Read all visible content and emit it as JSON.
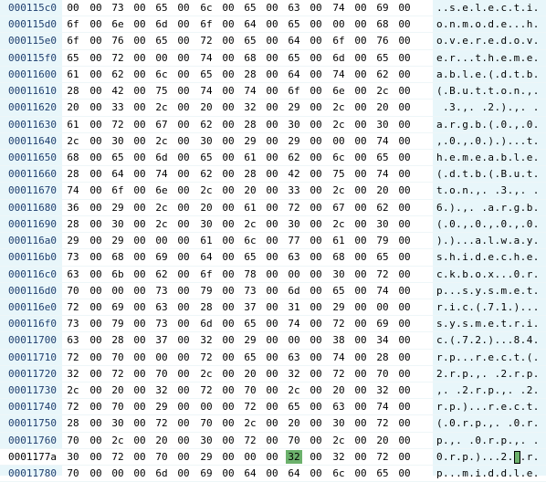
{
  "colors": {
    "address_column_bg": "#e8f6fa",
    "ascii_column_bg": "#e8f6fa",
    "highlight": "#6cb16c"
  },
  "rows": [
    {
      "addr": "000115c0",
      "bytes": [
        "00",
        "00",
        "73",
        "00",
        "65",
        "00",
        "6c",
        "00",
        "65",
        "00",
        "63",
        "00",
        "74",
        "00",
        "69",
        "00"
      ],
      "ascii": "..s.e.l.e.c.t.i."
    },
    {
      "addr": "000115d0",
      "bytes": [
        "6f",
        "00",
        "6e",
        "00",
        "6d",
        "00",
        "6f",
        "00",
        "64",
        "00",
        "65",
        "00",
        "00",
        "00",
        "68",
        "00"
      ],
      "ascii": "o.n.m.o.d.e...h."
    },
    {
      "addr": "000115e0",
      "bytes": [
        "6f",
        "00",
        "76",
        "00",
        "65",
        "00",
        "72",
        "00",
        "65",
        "00",
        "64",
        "00",
        "6f",
        "00",
        "76",
        "00"
      ],
      "ascii": "o.v.e.r.e.d.o.v."
    },
    {
      "addr": "000115f0",
      "bytes": [
        "65",
        "00",
        "72",
        "00",
        "00",
        "00",
        "74",
        "00",
        "68",
        "00",
        "65",
        "00",
        "6d",
        "00",
        "65",
        "00"
      ],
      "ascii": "e.r...t.h.e.m.e."
    },
    {
      "addr": "00011600",
      "bytes": [
        "61",
        "00",
        "62",
        "00",
        "6c",
        "00",
        "65",
        "00",
        "28",
        "00",
        "64",
        "00",
        "74",
        "00",
        "62",
        "00"
      ],
      "ascii": "a.b.l.e.(.d.t.b."
    },
    {
      "addr": "00011610",
      "bytes": [
        "28",
        "00",
        "42",
        "00",
        "75",
        "00",
        "74",
        "00",
        "74",
        "00",
        "6f",
        "00",
        "6e",
        "00",
        "2c",
        "00"
      ],
      "ascii": "(.B.u.t.t.o.n.,."
    },
    {
      "addr": "00011620",
      "bytes": [
        "20",
        "00",
        "33",
        "00",
        "2c",
        "00",
        "20",
        "00",
        "32",
        "00",
        "29",
        "00",
        "2c",
        "00",
        "20",
        "00"
      ],
      "ascii": " .3.,. .2.).,. ."
    },
    {
      "addr": "00011630",
      "bytes": [
        "61",
        "00",
        "72",
        "00",
        "67",
        "00",
        "62",
        "00",
        "28",
        "00",
        "30",
        "00",
        "2c",
        "00",
        "30",
        "00"
      ],
      "ascii": "a.r.g.b.(.0.,.0."
    },
    {
      "addr": "00011640",
      "bytes": [
        "2c",
        "00",
        "30",
        "00",
        "2c",
        "00",
        "30",
        "00",
        "29",
        "00",
        "29",
        "00",
        "00",
        "00",
        "74",
        "00"
      ],
      "ascii": ",.0.,.0.).)...t."
    },
    {
      "addr": "00011650",
      "bytes": [
        "68",
        "00",
        "65",
        "00",
        "6d",
        "00",
        "65",
        "00",
        "61",
        "00",
        "62",
        "00",
        "6c",
        "00",
        "65",
        "00"
      ],
      "ascii": "h.e.m.e.a.b.l.e."
    },
    {
      "addr": "00011660",
      "bytes": [
        "28",
        "00",
        "64",
        "00",
        "74",
        "00",
        "62",
        "00",
        "28",
        "00",
        "42",
        "00",
        "75",
        "00",
        "74",
        "00"
      ],
      "ascii": "(.d.t.b.(.B.u.t."
    },
    {
      "addr": "00011670",
      "bytes": [
        "74",
        "00",
        "6f",
        "00",
        "6e",
        "00",
        "2c",
        "00",
        "20",
        "00",
        "33",
        "00",
        "2c",
        "00",
        "20",
        "00"
      ],
      "ascii": "t.o.n.,. .3.,. ."
    },
    {
      "addr": "00011680",
      "bytes": [
        "36",
        "00",
        "29",
        "00",
        "2c",
        "00",
        "20",
        "00",
        "61",
        "00",
        "72",
        "00",
        "67",
        "00",
        "62",
        "00"
      ],
      "ascii": "6.).,. .a.r.g.b."
    },
    {
      "addr": "00011690",
      "bytes": [
        "28",
        "00",
        "30",
        "00",
        "2c",
        "00",
        "30",
        "00",
        "2c",
        "00",
        "30",
        "00",
        "2c",
        "00",
        "30",
        "00"
      ],
      "ascii": "(.0.,.0.,.0.,.0."
    },
    {
      "addr": "000116a0",
      "bytes": [
        "29",
        "00",
        "29",
        "00",
        "00",
        "00",
        "61",
        "00",
        "6c",
        "00",
        "77",
        "00",
        "61",
        "00",
        "79",
        "00"
      ],
      "ascii": ").)...a.l.w.a.y."
    },
    {
      "addr": "000116b0",
      "bytes": [
        "73",
        "00",
        "68",
        "00",
        "69",
        "00",
        "64",
        "00",
        "65",
        "00",
        "63",
        "00",
        "68",
        "00",
        "65",
        "00"
      ],
      "ascii": "s.h.i.d.e.c.h.e."
    },
    {
      "addr": "000116c0",
      "bytes": [
        "63",
        "00",
        "6b",
        "00",
        "62",
        "00",
        "6f",
        "00",
        "78",
        "00",
        "00",
        "00",
        "30",
        "00",
        "72",
        "00"
      ],
      "ascii": "c.k.b.o.x...0.r."
    },
    {
      "addr": "000116d0",
      "bytes": [
        "70",
        "00",
        "00",
        "00",
        "73",
        "00",
        "79",
        "00",
        "73",
        "00",
        "6d",
        "00",
        "65",
        "00",
        "74",
        "00"
      ],
      "ascii": "p...s.y.s.m.e.t."
    },
    {
      "addr": "000116e0",
      "bytes": [
        "72",
        "00",
        "69",
        "00",
        "63",
        "00",
        "28",
        "00",
        "37",
        "00",
        "31",
        "00",
        "29",
        "00",
        "00",
        "00"
      ],
      "ascii": "r.i.c.(.7.1.)..."
    },
    {
      "addr": "000116f0",
      "bytes": [
        "73",
        "00",
        "79",
        "00",
        "73",
        "00",
        "6d",
        "00",
        "65",
        "00",
        "74",
        "00",
        "72",
        "00",
        "69",
        "00"
      ],
      "ascii": "s.y.s.m.e.t.r.i."
    },
    {
      "addr": "00011700",
      "bytes": [
        "63",
        "00",
        "28",
        "00",
        "37",
        "00",
        "32",
        "00",
        "29",
        "00",
        "00",
        "00",
        "38",
        "00",
        "34",
        "00"
      ],
      "ascii": "c.(.7.2.)...8.4."
    },
    {
      "addr": "00011710",
      "bytes": [
        "72",
        "00",
        "70",
        "00",
        "00",
        "00",
        "72",
        "00",
        "65",
        "00",
        "63",
        "00",
        "74",
        "00",
        "28",
        "00"
      ],
      "ascii": "r.p...r.e.c.t.(."
    },
    {
      "addr": "00011720",
      "bytes": [
        "32",
        "00",
        "72",
        "00",
        "70",
        "00",
        "2c",
        "00",
        "20",
        "00",
        "32",
        "00",
        "72",
        "00",
        "70",
        "00"
      ],
      "ascii": "2.r.p.,. .2.r.p."
    },
    {
      "addr": "00011730",
      "bytes": [
        "2c",
        "00",
        "20",
        "00",
        "32",
        "00",
        "72",
        "00",
        "70",
        "00",
        "2c",
        "00",
        "20",
        "00",
        "32",
        "00"
      ],
      "ascii": ",. .2.r.p.,. .2."
    },
    {
      "addr": "00011740",
      "bytes": [
        "72",
        "00",
        "70",
        "00",
        "29",
        "00",
        "00",
        "00",
        "72",
        "00",
        "65",
        "00",
        "63",
        "00",
        "74",
        "00"
      ],
      "ascii": "r.p.)...r.e.c.t."
    },
    {
      "addr": "00011750",
      "bytes": [
        "28",
        "00",
        "30",
        "00",
        "72",
        "00",
        "70",
        "00",
        "2c",
        "00",
        "20",
        "00",
        "30",
        "00",
        "72",
        "00"
      ],
      "ascii": "(.0.r.p.,. .0.r."
    },
    {
      "addr": "00011760",
      "bytes": [
        "70",
        "00",
        "2c",
        "00",
        "20",
        "00",
        "30",
        "00",
        "72",
        "00",
        "70",
        "00",
        "2c",
        "00",
        "20",
        "00"
      ],
      "ascii": "p.,. .0.r.p.,. ."
    },
    {
      "addr": "0001177a",
      "bytes": [
        "30",
        "00",
        "72",
        "00",
        "70",
        "00",
        "29",
        "00",
        "00",
        "00",
        "32",
        "00",
        "32",
        "00",
        "72",
        "00"
      ],
      "ascii": "0.r.p.)...2.2.r."
    },
    {
      "addr": "00011780",
      "bytes": [
        "70",
        "00",
        "00",
        "00",
        "6d",
        "00",
        "69",
        "00",
        "64",
        "00",
        "64",
        "00",
        "6c",
        "00",
        "65",
        "00"
      ],
      "ascii": "p...m.i.d.d.l.e."
    }
  ],
  "current_row": 27,
  "highlight_byte": 10,
  "ascii_caret_char": 12
}
